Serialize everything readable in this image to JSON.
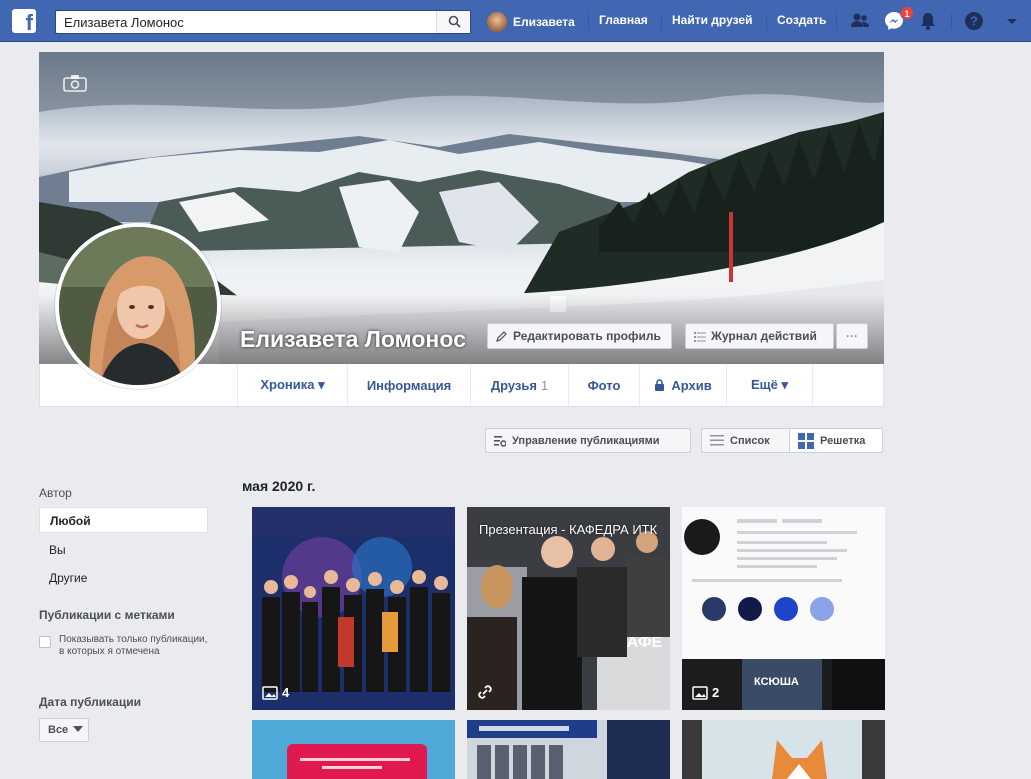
{
  "topbar": {
    "search_value": "Елизавета Ломонос",
    "user_name": "Елизавета",
    "links": {
      "home": "Главная",
      "find_friends": "Найти друзей",
      "create": "Создать"
    },
    "messenger_badge": "1",
    "colors": {
      "brand": "#4267b2",
      "badge": "#fa3e3e"
    }
  },
  "profile": {
    "name": "Елизавета Ломонос",
    "edit_profile": "Редактировать профиль",
    "activity_log": "Журнал действий",
    "more": "···"
  },
  "tabs": {
    "timeline": "Хроника ▾",
    "about": "Информация",
    "friends": "Друзья",
    "friends_count": "1",
    "photos": "Фото",
    "archive": "Архив",
    "more": "Ещё ▾"
  },
  "toolbar": {
    "manage_posts": "Управление публикациями",
    "list": "Список",
    "grid": "Решетка"
  },
  "filters": {
    "author_heading": "Автор",
    "author_options": [
      "Любой",
      "Вы",
      "Другие"
    ],
    "tagged_heading": "Публикации с метками",
    "tagged_checkbox": "Показывать только публикации, в которых я отмечена",
    "date_heading": "Дата публикации",
    "date_value": "Все"
  },
  "posts": {
    "month": "мая 2020 г.",
    "items": [
      {
        "caption": "",
        "photo_count": "4"
      },
      {
        "caption": "Презентация - КАФЕДРА ИТК",
        "photo_count": ""
      },
      {
        "caption": "",
        "photo_count": "2"
      }
    ]
  }
}
